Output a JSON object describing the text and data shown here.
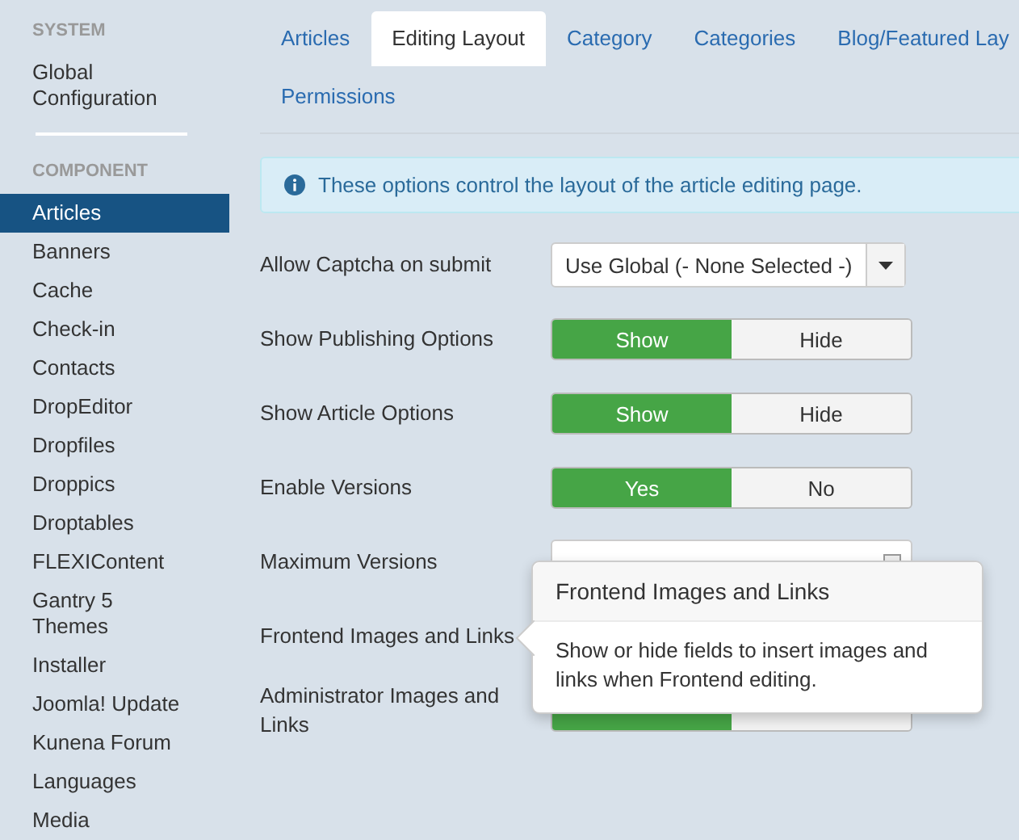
{
  "sidebar": {
    "sections": [
      {
        "heading": "SYSTEM",
        "items": [
          {
            "label": "Global Configuration",
            "selected": false
          }
        ]
      },
      {
        "heading": "COMPONENT",
        "items": [
          {
            "label": "Articles",
            "selected": true
          },
          {
            "label": "Banners",
            "selected": false
          },
          {
            "label": "Cache",
            "selected": false
          },
          {
            "label": "Check-in",
            "selected": false
          },
          {
            "label": "Contacts",
            "selected": false
          },
          {
            "label": "DropEditor",
            "selected": false
          },
          {
            "label": "Dropfiles",
            "selected": false
          },
          {
            "label": "Droppics",
            "selected": false
          },
          {
            "label": "Droptables",
            "selected": false
          },
          {
            "label": "FLEXIContent",
            "selected": false
          },
          {
            "label": "Gantry 5 Themes",
            "selected": false
          },
          {
            "label": "Installer",
            "selected": false
          },
          {
            "label": "Joomla! Update",
            "selected": false
          },
          {
            "label": "Kunena Forum",
            "selected": false
          },
          {
            "label": "Languages",
            "selected": false
          },
          {
            "label": "Media",
            "selected": false
          }
        ]
      }
    ]
  },
  "tabs": [
    {
      "label": "Articles",
      "selected": false
    },
    {
      "label": "Editing Layout",
      "selected": true
    },
    {
      "label": "Category",
      "selected": false
    },
    {
      "label": "Categories",
      "selected": false
    },
    {
      "label": "Blog/Featured Lay",
      "selected": false
    },
    {
      "label": "Permissions",
      "selected": false
    }
  ],
  "alert": {
    "text": "These options control the layout of the article editing page."
  },
  "fields": [
    {
      "kind": "select",
      "label": "Allow Captcha on submit",
      "value": "Use Global (- None Selected -)"
    },
    {
      "kind": "toggle",
      "label": "Show Publishing Options",
      "options": [
        {
          "label": "Show",
          "selected": true
        },
        {
          "label": "Hide",
          "selected": false
        }
      ]
    },
    {
      "kind": "toggle",
      "label": "Show Article Options",
      "options": [
        {
          "label": "Show",
          "selected": true
        },
        {
          "label": "Hide",
          "selected": false
        }
      ]
    },
    {
      "kind": "toggle",
      "label": "Enable Versions",
      "options": [
        {
          "label": "Yes",
          "selected": true
        },
        {
          "label": "No",
          "selected": false
        }
      ]
    },
    {
      "kind": "number",
      "label": "Maximum Versions"
    },
    {
      "kind": "hidden",
      "label": "Frontend Images and Links"
    },
    {
      "kind": "toggle",
      "label": "Administrator Images and Links",
      "options": [
        {
          "selected": true
        },
        {
          "selected": false
        }
      ]
    }
  ],
  "tooltip": {
    "title": "Frontend Images and Links",
    "text": "Show or hide fields to insert images and links when Frontend editing."
  }
}
